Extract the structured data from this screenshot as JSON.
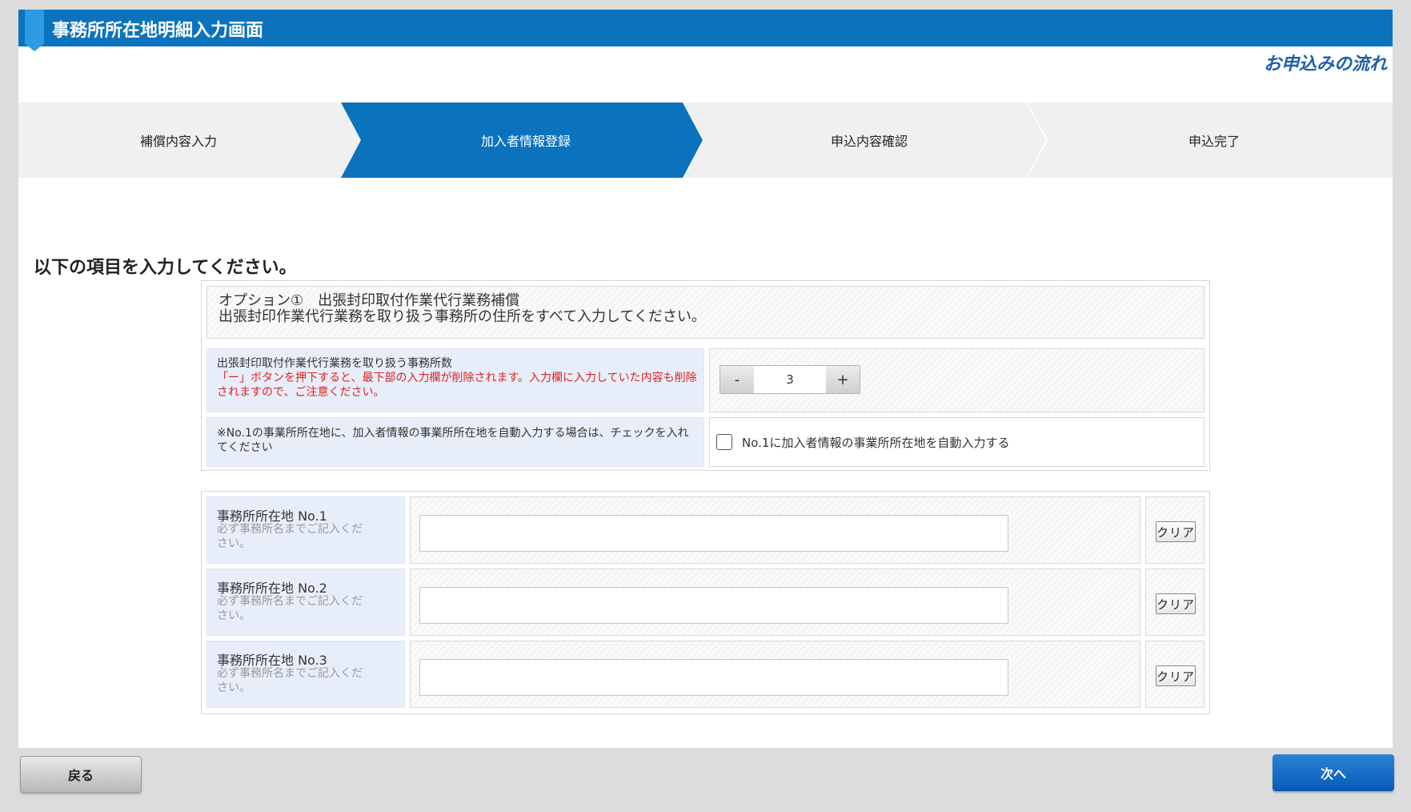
{
  "header": {
    "title": "事務所所在地明細入力画面",
    "flow_link": "お申込みの流れ"
  },
  "steps": [
    {
      "label": "補償内容入力",
      "active": false
    },
    {
      "label": "加入者情報登録",
      "active": true
    },
    {
      "label": "申込内容確認",
      "active": false
    },
    {
      "label": "申込完了",
      "active": false
    }
  ],
  "instruction": "以下の項目を入力してください。",
  "option": {
    "title": "オプション①　出張封印取付作業代行業務補償",
    "description": "出張封印作業代行業務を取り扱う事務所の住所をすべて入力してください。"
  },
  "office_count": {
    "label": "出張封印取付作業代行業務を取り扱う事務所数",
    "warning": "「ー」ボタンを押下すると、最下部の入力欄が削除されます。入力欄に入力していた内容も削除されますので、ご注意ください。",
    "minus_label": "-",
    "value": "3",
    "plus_label": "+"
  },
  "autofill": {
    "note": "※No.1の事業所所在地に、加入者情報の事業所所在地を自動入力する場合は、チェックを入れてください",
    "checkbox_label": "No.1に加入者情報の事業所所在地を自動入力する",
    "checked": false
  },
  "addresses": [
    {
      "label": "事務所所在地 No.1",
      "note": "必ず事務所名までご記入ください。",
      "value": "",
      "clear_label": "クリア"
    },
    {
      "label": "事務所所在地 No.2",
      "note": "必ず事務所名までご記入ください。",
      "value": "",
      "clear_label": "クリア"
    },
    {
      "label": "事務所所在地 No.3",
      "note": "必ず事務所名までご記入ください。",
      "value": "",
      "clear_label": "クリア"
    }
  ],
  "footer": {
    "back_label": "戻る",
    "next_label": "次へ"
  },
  "colors": {
    "brand_blue": "#0b73be",
    "warning_red": "#e02020",
    "label_bg": "#e7eefa"
  }
}
